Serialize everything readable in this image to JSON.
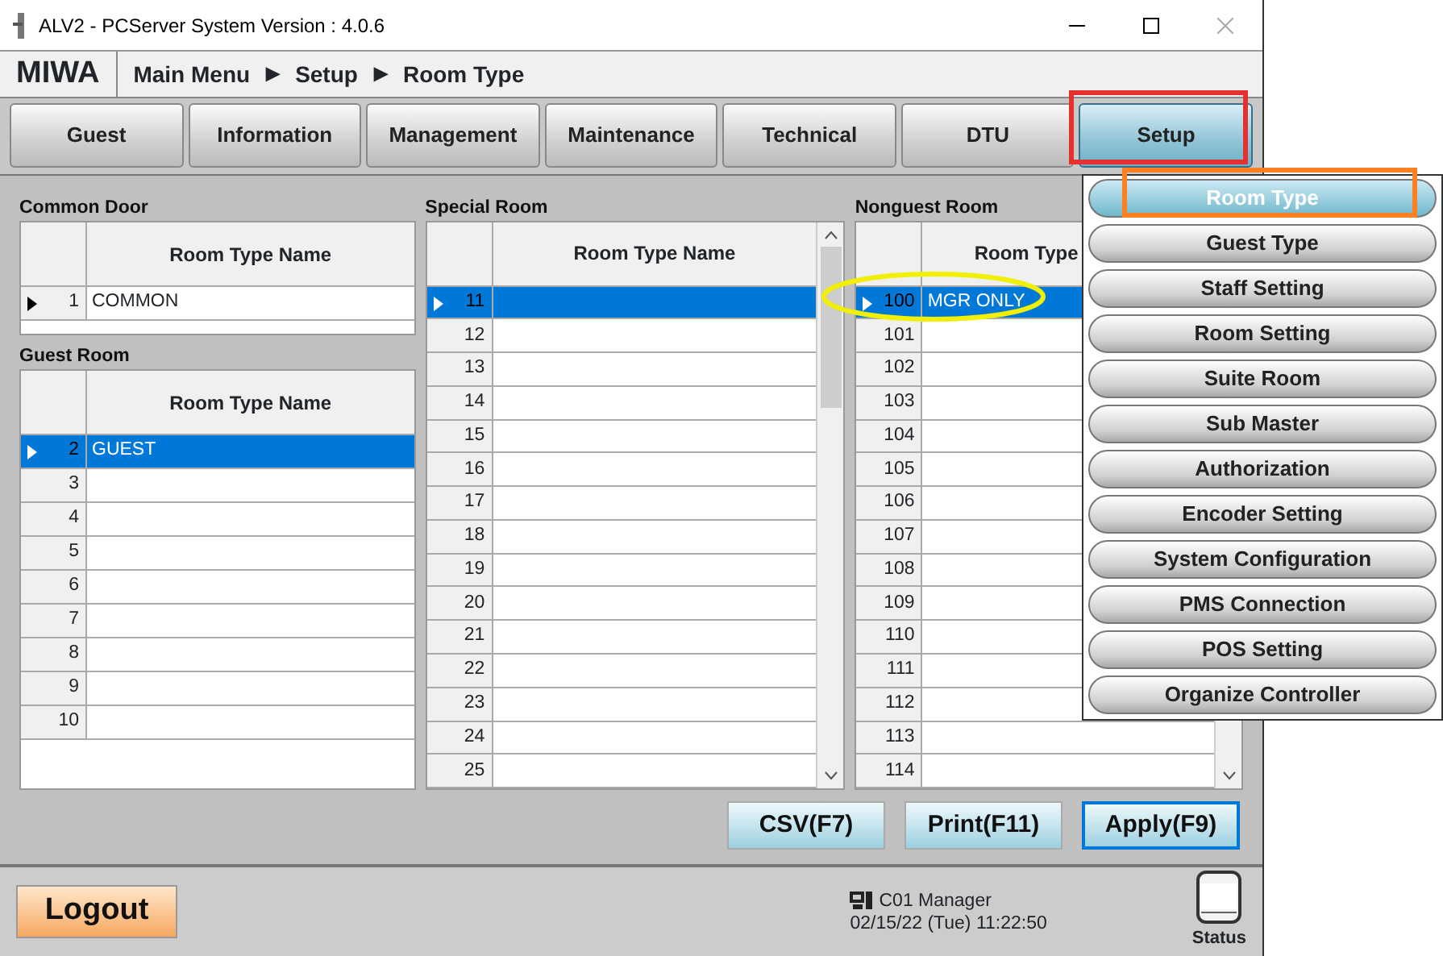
{
  "window": {
    "title": "ALV2 - PCServer System Version : 4.0.6"
  },
  "header": {
    "logo": "MIWA",
    "breadcrumb": [
      "Main Menu",
      "Setup",
      "Room Type"
    ],
    "separator": "▶"
  },
  "tabs": [
    {
      "label": "Guest",
      "selected": false
    },
    {
      "label": "Information",
      "selected": false
    },
    {
      "label": "Management",
      "selected": false
    },
    {
      "label": "Maintenance",
      "selected": false
    },
    {
      "label": "Technical",
      "selected": false
    },
    {
      "label": "DTU",
      "selected": false
    },
    {
      "label": "Setup",
      "selected": true
    }
  ],
  "tables": [
    {
      "title": "Common Door",
      "column": "Room Type Name",
      "rows": [
        {
          "number": "1",
          "name": "COMMON",
          "selected": false,
          "current": true
        }
      ]
    },
    {
      "title": "Guest Room",
      "column": "Room Type Name",
      "rows": [
        {
          "number": "2",
          "name": "GUEST",
          "selected": true,
          "current": true
        },
        {
          "number": "3",
          "selected": false,
          "current": false
        },
        {
          "number": "4",
          "selected": false,
          "current": false
        },
        {
          "number": "5",
          "selected": false,
          "current": false
        },
        {
          "number": "6",
          "selected": false,
          "current": false
        },
        {
          "number": "7",
          "selected": false,
          "current": false
        },
        {
          "number": "8",
          "selected": false,
          "current": false
        },
        {
          "number": "9",
          "selected": false,
          "current": false
        },
        {
          "number": "10",
          "selected": false,
          "current": false
        }
      ]
    },
    {
      "title": "Special Room",
      "column": "Room Type Name",
      "rows": [
        {
          "number": "11",
          "selected": true,
          "current": true
        },
        {
          "number": "12",
          "selected": false,
          "current": false
        },
        {
          "number": "13",
          "selected": false,
          "current": false
        },
        {
          "number": "14",
          "selected": false,
          "current": false
        },
        {
          "number": "15",
          "selected": false,
          "current": false
        },
        {
          "number": "16",
          "selected": false,
          "current": false
        },
        {
          "number": "17",
          "selected": false,
          "current": false
        },
        {
          "number": "18",
          "selected": false,
          "current": false
        },
        {
          "number": "19",
          "selected": false,
          "current": false
        },
        {
          "number": "20",
          "selected": false,
          "current": false
        },
        {
          "number": "21",
          "selected": false,
          "current": false
        },
        {
          "number": "22",
          "selected": false,
          "current": false
        },
        {
          "number": "23",
          "selected": false,
          "current": false
        },
        {
          "number": "24",
          "selected": false,
          "current": false
        },
        {
          "number": "25",
          "selected": false,
          "current": false
        }
      ]
    },
    {
      "title": "Nonguest Room",
      "column": "Room Type",
      "rows": [
        {
          "number": "100",
          "name": "MGR ONLY",
          "selected": true,
          "current": true
        },
        {
          "number": "101",
          "selected": false,
          "current": false
        },
        {
          "number": "102",
          "selected": false,
          "current": false
        },
        {
          "number": "103",
          "selected": false,
          "current": false
        },
        {
          "number": "104",
          "selected": false,
          "current": false
        },
        {
          "number": "105",
          "selected": false,
          "current": false
        },
        {
          "number": "106",
          "selected": false,
          "current": false
        },
        {
          "number": "107",
          "selected": false,
          "current": false
        },
        {
          "number": "108",
          "selected": false,
          "current": false
        },
        {
          "number": "109",
          "selected": false,
          "current": false
        },
        {
          "number": "110",
          "selected": false,
          "current": false
        },
        {
          "number": "111",
          "selected": false,
          "current": false
        },
        {
          "number": "112",
          "selected": false,
          "current": false
        },
        {
          "number": "113",
          "selected": false,
          "current": false
        },
        {
          "number": "114",
          "selected": false,
          "current": false
        }
      ]
    }
  ],
  "actions": [
    {
      "label": "CSV(F7)",
      "focused": false
    },
    {
      "label": "Print(F11)",
      "focused": false
    },
    {
      "label": "Apply(F9)",
      "focused": true
    }
  ],
  "status_bar": {
    "logout": "Logout",
    "user": "C01 Manager",
    "datetime": "02/15/22 (Tue) 11:22:50",
    "status": "Status"
  },
  "setup_menu": [
    {
      "label": "Room Type",
      "selected": true
    },
    {
      "label": "Guest Type",
      "selected": false
    },
    {
      "label": "Staff Setting",
      "selected": false
    },
    {
      "label": "Room Setting",
      "selected": false
    },
    {
      "label": "Suite Room",
      "selected": false
    },
    {
      "label": "Sub Master",
      "selected": false
    },
    {
      "label": "Authorization",
      "selected": false
    },
    {
      "label": "Encoder Setting",
      "selected": false
    },
    {
      "label": "System Configuration",
      "selected": false
    },
    {
      "label": "PMS Connection",
      "selected": false
    },
    {
      "label": "POS Setting",
      "selected": false
    },
    {
      "label": "Organize Controller",
      "selected": false
    }
  ]
}
